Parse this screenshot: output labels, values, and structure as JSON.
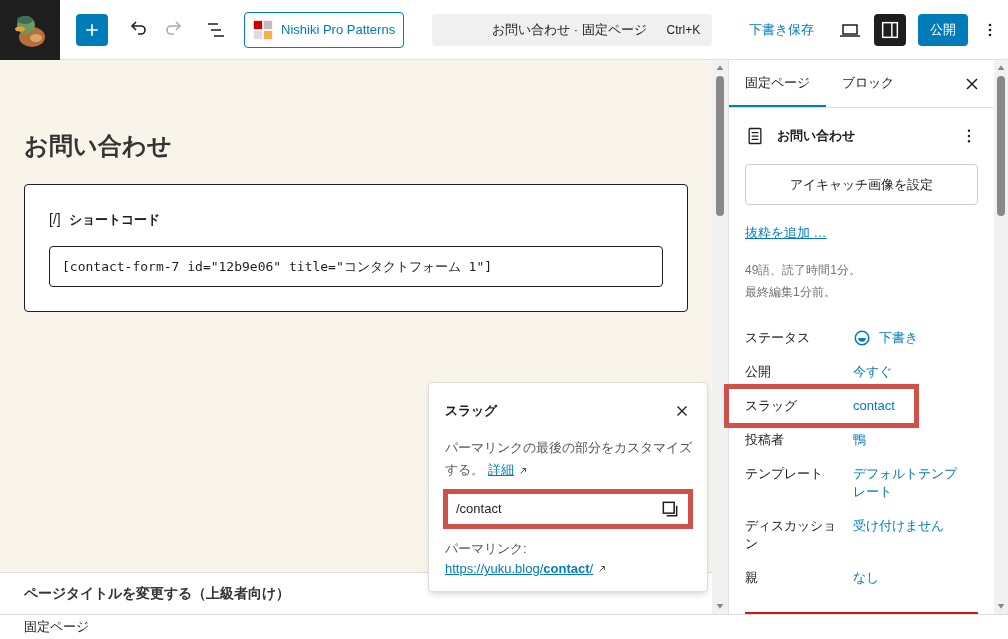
{
  "toolbar": {
    "pattern_button": "Nishiki Pro Patterns",
    "command_bar": {
      "title": "お問い合わせ · 固定ページ",
      "shortcut": "Ctrl+K"
    },
    "save_draft": "下書き保存",
    "settings_toggle": {
      "on": true
    },
    "publish": "公開"
  },
  "editor": {
    "page_title": "お問い合わせ",
    "block": {
      "icon": "[/]",
      "title": "ショートコード",
      "value": "[contact-form-7 id=\"12b9e06\" title=\"コンタクトフォーム 1\"]"
    },
    "metabox": "ページタイトルを変更する（上級者向け）"
  },
  "popover": {
    "title": "スラッグ",
    "description": "パーマリンクの最後の部分をカスタマイズする。",
    "link": "詳細",
    "field_value": "/contact",
    "highlighted": true,
    "permalink_label": "パーマリンク:",
    "permalink_url": "https://yuku.blog/**contact**/"
  },
  "sidebar": {
    "tabs": [
      {
        "label": "固定ページ",
        "selected": true
      },
      {
        "label": "ブロック",
        "selected": false
      }
    ],
    "post_title": "お問い合わせ",
    "featured_image_button": "アイキャッチ画像を設定",
    "excerpt_link": "抜粋を追加 …",
    "stats": [
      "49語、読了時間1分。",
      "最終編集1分前。"
    ],
    "fields": [
      {
        "kind": "status",
        "label": "ステータス",
        "value": "下書き",
        "highlighted": false
      },
      {
        "kind": "plain",
        "label": "公開",
        "value": "今すぐ",
        "highlighted": false
      },
      {
        "kind": "plain",
        "label": "スラッグ",
        "value": "contact",
        "highlighted": true
      },
      {
        "kind": "plain",
        "label": "投稿者",
        "value": "鴨",
        "highlighted": false
      },
      {
        "kind": "plain",
        "label": "テンプレート",
        "value": "デフォルトテンプレート",
        "highlighted": false
      },
      {
        "kind": "plain",
        "label": "ディスカッション",
        "value": "受け付けません",
        "highlighted": false
      },
      {
        "kind": "plain",
        "label": "親",
        "value": "なし",
        "highlighted": false
      }
    ]
  },
  "status_bar": "固定ページ"
}
